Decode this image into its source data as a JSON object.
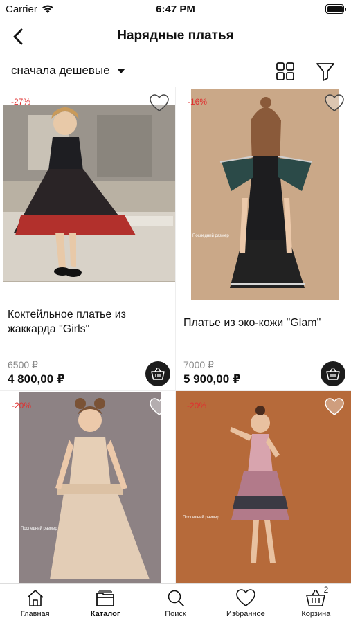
{
  "status_bar": {
    "carrier": "Carrier",
    "time": "6:47 PM"
  },
  "header": {
    "title": "Нарядные платья",
    "back_icon": "chevron-left-icon"
  },
  "toolbar": {
    "sort_label": "сначала дешевые",
    "view_icon": "grid-view-icon",
    "filter_icon": "filter-icon"
  },
  "products": [
    {
      "discount": "-27%",
      "name": "Коктейльное платье из жаккарда \"Girls\"",
      "old_price": "6500 ₽",
      "price": "4 800,00 ₽"
    },
    {
      "discount": "-16%",
      "name": "Платье из эко-кожи \"Glam\"",
      "old_price": "7000 ₽",
      "price": "5 900,00 ₽"
    },
    {
      "discount": "-20%",
      "name": "",
      "old_price": "",
      "price": ""
    },
    {
      "discount": "-20%",
      "name": "",
      "old_price": "",
      "price": ""
    }
  ],
  "tabbar": {
    "items": [
      {
        "label": "Главная",
        "icon": "home-icon"
      },
      {
        "label": "Каталог",
        "icon": "catalog-icon"
      },
      {
        "label": "Поиск",
        "icon": "search-icon"
      },
      {
        "label": "Избранное",
        "icon": "heart-icon"
      },
      {
        "label": "Корзина",
        "icon": "basket-icon"
      }
    ],
    "active": "Каталог",
    "cart_count": "2"
  },
  "colors": {
    "discount": "#e03030",
    "cart_button": "#1c1c1c"
  }
}
